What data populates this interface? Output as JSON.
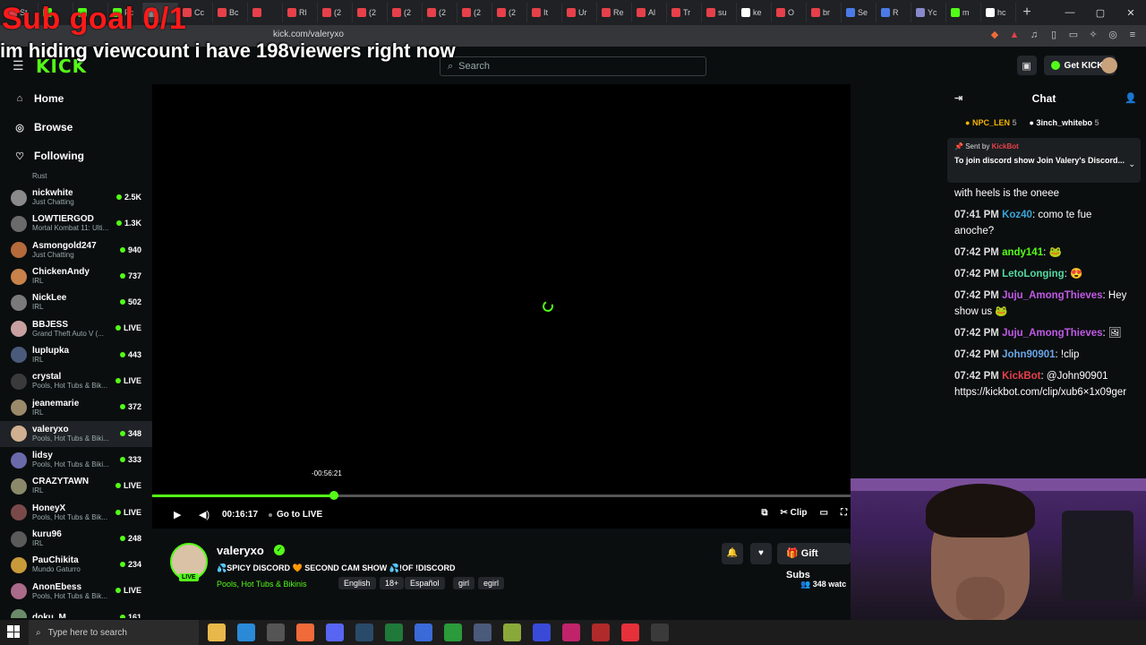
{
  "browser": {
    "tabs": [
      {
        "label": "St",
        "color": "#e6404a"
      },
      {
        "label": "",
        "color": "#53fc18"
      },
      {
        "label": "",
        "color": "#53fc18"
      },
      {
        "label": "Fc",
        "color": "#53fc18"
      },
      {
        "label": "",
        "color": "#888888"
      },
      {
        "label": "Cc",
        "color": "#e6404a"
      },
      {
        "label": "Bc",
        "color": "#e6404a"
      },
      {
        "label": "",
        "color": "#e6404a"
      },
      {
        "label": "Rl",
        "color": "#e6404a"
      },
      {
        "label": "(2",
        "color": "#e6404a"
      },
      {
        "label": "(2",
        "color": "#e6404a"
      },
      {
        "label": "(2",
        "color": "#e6404a"
      },
      {
        "label": "(2",
        "color": "#e6404a"
      },
      {
        "label": "(2",
        "color": "#e6404a"
      },
      {
        "label": "(2",
        "color": "#e6404a"
      },
      {
        "label": "It",
        "color": "#e6404a"
      },
      {
        "label": "Ur",
        "color": "#e6404a"
      },
      {
        "label": "Re",
        "color": "#e6404a"
      },
      {
        "label": "Al",
        "color": "#e6404a"
      },
      {
        "label": "Tr",
        "color": "#e6404a"
      },
      {
        "label": "su",
        "color": "#e6404a"
      },
      {
        "label": "ke",
        "color": "#ffffff"
      },
      {
        "label": "O",
        "color": "#e6404a"
      },
      {
        "label": "br",
        "color": "#e6404a"
      },
      {
        "label": "Se",
        "color": "#4a7ae6"
      },
      {
        "label": "R",
        "color": "#4a7ae6"
      },
      {
        "label": "Yc",
        "color": "#8888cc"
      },
      {
        "label": "m",
        "color": "#53fc18"
      },
      {
        "label": "hc",
        "color": "#ffffff"
      }
    ],
    "url": "kick.com/valeryxo"
  },
  "overlay": {
    "line1": "Sub goal 0/1",
    "line2": "im hiding viewcount i have 198viewers right now"
  },
  "header": {
    "logo": "KICK",
    "search_placeholder": "Search",
    "get_kicks": "Get KICKs"
  },
  "sidebar": {
    "nav": [
      {
        "label": "Home",
        "icon": "home-icon"
      },
      {
        "label": "Browse",
        "icon": "compass-icon"
      },
      {
        "label": "Following",
        "icon": "heart-icon"
      }
    ],
    "partial_category": "Rust",
    "channels": [
      {
        "name": "nickwhite",
        "game": "Just Chatting",
        "viewers": "2.5K",
        "color": "#8a8a8a"
      },
      {
        "name": "LOWTIERGOD",
        "game": "Mortal Kombat 11: Ulti...",
        "viewers": "1.3K",
        "color": "#6a6a6a"
      },
      {
        "name": "Asmongold247",
        "game": "Just Chatting",
        "viewers": "940",
        "color": "#b46a3a"
      },
      {
        "name": "ChickenAndy",
        "game": "IRL",
        "viewers": "737",
        "color": "#c8824a"
      },
      {
        "name": "NickLee",
        "game": "IRL",
        "viewers": "502",
        "color": "#7a7a7a"
      },
      {
        "name": "BBJESS",
        "game": "Grand Theft Auto V (...",
        "viewers": "LIVE",
        "color": "#c8a0a0"
      },
      {
        "name": "lupIupka",
        "game": "IRL",
        "viewers": "443",
        "color": "#4a5a7a"
      },
      {
        "name": "crystal",
        "game": "Pools, Hot Tubs & Bik...",
        "viewers": "LIVE",
        "color": "#3a3a3a"
      },
      {
        "name": "jeanemarie",
        "game": "IRL",
        "viewers": "372",
        "color": "#9a8a6a"
      },
      {
        "name": "valeryxo",
        "game": "Pools, Hot Tubs & Biki...",
        "viewers": "348",
        "color": "#d0b090"
      },
      {
        "name": "lidsy",
        "game": "Pools, Hot Tubs & Biki...",
        "viewers": "333",
        "color": "#6a6aaa"
      },
      {
        "name": "CRAZYTAWN",
        "game": "IRL",
        "viewers": "LIVE",
        "color": "#8a8a6a"
      },
      {
        "name": "HoneyX",
        "game": "Pools, Hot Tubs & Bik...",
        "viewers": "LIVE",
        "color": "#7a4a4a"
      },
      {
        "name": "kuru96",
        "game": "IRL",
        "viewers": "248",
        "color": "#5a5a5a"
      },
      {
        "name": "PauChikita",
        "game": "Mundo Gaturro",
        "viewers": "234",
        "color": "#c89a3a"
      },
      {
        "name": "AnonEbess",
        "game": "Pools, Hot Tubs & Bik...",
        "viewers": "LIVE",
        "color": "#aa6a8a"
      },
      {
        "name": "doku_M",
        "game": "",
        "viewers": "161",
        "color": "#6a8a6a"
      }
    ]
  },
  "player": {
    "seek_tooltip": "-00:56:21",
    "progress": 0.26,
    "time": "00:16:17",
    "go_live": "Go to LIVE",
    "clip": "Clip"
  },
  "stream": {
    "name": "valeryxo",
    "live_badge": "LIVE",
    "title": "💦SPICY DISCORD 🧡 SECOND CAM SHOW 💦!OF !DISCORD",
    "category": "Pools, Hot Tubs & Bikinis",
    "tags": [
      "English",
      "18+",
      "Español",
      "girl",
      "egirl"
    ],
    "gift_subs": "Gift Subs",
    "viewers": "348 watc"
  },
  "chat": {
    "title": "Chat",
    "top_gifters": [
      {
        "name": "NPC_LEN",
        "count": "5"
      },
      {
        "name": "3inch_whitebo",
        "count": "5"
      }
    ],
    "pinned": {
      "sent_by_label": "Sent by",
      "sender": "KickBot",
      "message": "To join discord show Join Valery's Discord..."
    },
    "messages": [
      {
        "time": "",
        "user": "",
        "color": "#ffffff",
        "text": "with heels is the oneee"
      },
      {
        "time": "07:41 PM",
        "user": "Koz40",
        "color": "#3aa6d8",
        "text": "como te fue anoche?"
      },
      {
        "time": "07:42 PM",
        "user": "andy141",
        "color": "#53fc18",
        "text": "🐸"
      },
      {
        "time": "07:42 PM",
        "user": "LetoLonging",
        "color": "#53d8a0",
        "text": "😍"
      },
      {
        "time": "07:42 PM",
        "user": "Juju_AmongThieves",
        "color": "#c05ae6",
        "text": "Hey show us 🐸"
      },
      {
        "time": "07:42 PM",
        "user": "Juju_AmongThieves",
        "color": "#c05ae6",
        "text": "🖼"
      },
      {
        "time": "07:42 PM",
        "user": "John90901",
        "color": "#6aa6e6",
        "text": "!clip"
      },
      {
        "time": "07:42 PM",
        "user": "KickBot",
        "color": "#e6404a",
        "text": "@John90901 https://kickbot.com/clip/xub6×1x09ger"
      }
    ]
  },
  "taskbar": {
    "search_placeholder": "Type here to search"
  }
}
